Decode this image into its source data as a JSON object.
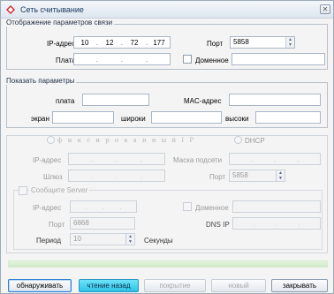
{
  "window": {
    "title": "Сеть считывание",
    "close_glyph": "✕"
  },
  "connection": {
    "legend": "Отображение параметров связи",
    "ip_label": "IP-адрес",
    "ip": [
      "10",
      "12",
      "72",
      "177"
    ],
    "port_label": "Порт",
    "port_value": "5858",
    "board_label": "Плата",
    "domain_label": "Доменное"
  },
  "show_params": {
    "legend": "Показать параметры",
    "board_label": "плата",
    "mac_label": "MAC-адрес",
    "screen_label": "экран",
    "width_label": "широки",
    "height_label": "высоки"
  },
  "network": {
    "fixed_ip_label": "ф и к с и р о в а н н ы й  I P",
    "dhcp_label": "DHCP",
    "ip_label": "IP-адрес",
    "mask_label": "Маска подсети",
    "gateway_label": "Шлюз",
    "port_label": "Порт",
    "port_value": "5858"
  },
  "server": {
    "legend": "Сообщите Server",
    "ip_label": "IP-адрес",
    "domain_label": "Доменное",
    "port_label": "Порт",
    "port_value": "6868",
    "dns_label": "DNS IP",
    "period_label": "Период",
    "period_value": "10",
    "seconds_label": "Секунды"
  },
  "buttons": {
    "detect": "обнаруживать",
    "read_back": "чтение назад",
    "cover": "покрытие",
    "new": "новый",
    "close": "закрывать"
  },
  "colors": {
    "accent_button": "#2cc3e8",
    "green_strip": "#cfe9c6",
    "title_text": "#1d3b62"
  }
}
